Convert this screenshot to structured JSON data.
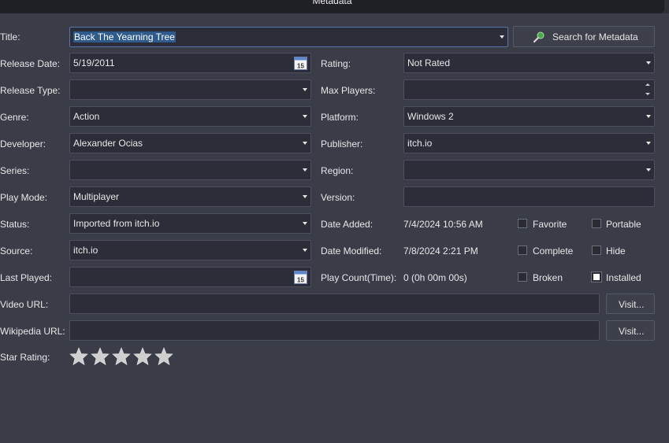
{
  "header": {
    "title": "Metadata"
  },
  "labels": {
    "title": "Title:",
    "release_date": "Release Date:",
    "release_type": "Release Type:",
    "genre": "Genre:",
    "developer": "Developer:",
    "series": "Series:",
    "play_mode": "Play Mode:",
    "status": "Status:",
    "source": "Source:",
    "last_played": "Last Played:",
    "video_url": "Video URL:",
    "wikipedia_url": "Wikipedia URL:",
    "star_rating": "Star Rating:",
    "rating": "Rating:",
    "max_players": "Max Players:",
    "platform": "Platform:",
    "publisher": "Publisher:",
    "region": "Region:",
    "version": "Version:",
    "date_added": "Date Added:",
    "date_modified": "Date Modified:",
    "play_count": "Play Count(Time):"
  },
  "values": {
    "title": "Back The Yearning Tree",
    "release_date": "5/19/2011",
    "release_type": "",
    "genre": "Action",
    "developer": "Alexander Ocias",
    "series": "",
    "play_mode": "Multiplayer",
    "status": "Imported from itch.io",
    "source": "itch.io",
    "last_played": "",
    "video_url": "",
    "wikipedia_url": "",
    "rating": "Not Rated",
    "max_players": "",
    "platform": "Windows 2",
    "publisher": "itch.io",
    "region": "",
    "version": "",
    "date_added": "7/4/2024 10:56 AM",
    "date_modified": "7/8/2024 2:21 PM",
    "play_count": "0 (0h 00m 00s)",
    "star_rating": 0,
    "star_max": 5
  },
  "calendar_day": "15",
  "buttons": {
    "search_metadata": "Search for Metadata",
    "visit_video": "Visit...",
    "visit_wikipedia": "Visit..."
  },
  "checkboxes": {
    "favorite": {
      "label": "Favorite",
      "checked": false
    },
    "portable": {
      "label": "Portable",
      "checked": false
    },
    "complete": {
      "label": "Complete",
      "checked": false
    },
    "hide": {
      "label": "Hide",
      "checked": false
    },
    "broken": {
      "label": "Broken",
      "checked": false
    },
    "installed": {
      "label": "Installed",
      "checked": true
    }
  },
  "colors": {
    "background": "#3a3c48",
    "field": "#2c2d38",
    "selection": "#2e5a8c",
    "star": "#cfcfcf"
  }
}
